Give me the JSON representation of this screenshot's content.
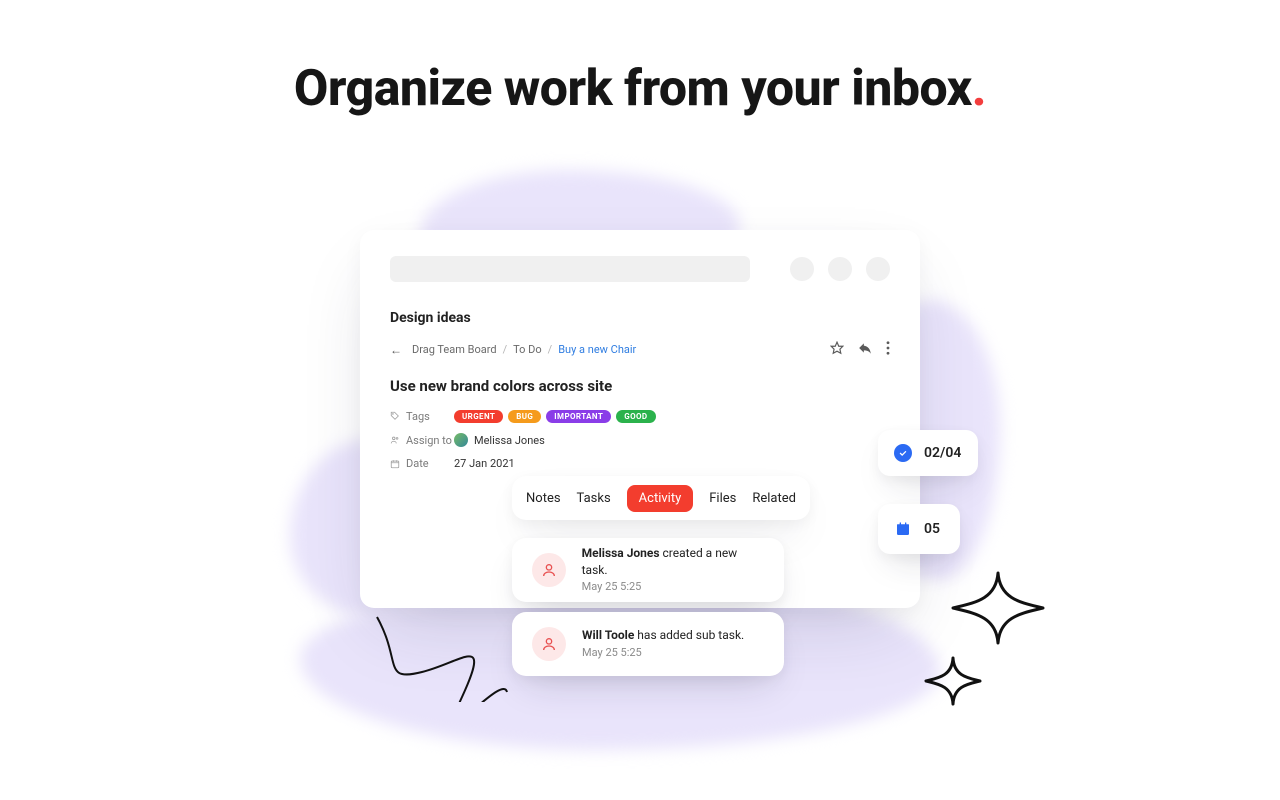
{
  "headline": "Organize work from your inbox",
  "card": {
    "section_title": "Design ideas",
    "breadcrumbs": {
      "b1": "Drag Team Board",
      "b2": "To Do",
      "b3": "Buy a new Chair"
    },
    "task_title": "Use new brand colors across site",
    "tags_label": "Tags",
    "tags": [
      {
        "text": "URGENT",
        "color": "#f33d2e"
      },
      {
        "text": "BUG",
        "color": "#f59b1c"
      },
      {
        "text": "IMPORTANT",
        "color": "#8a3de8"
      },
      {
        "text": "GOOD",
        "color": "#2bb24c"
      }
    ],
    "assign_label": "Assign to",
    "assignee": "Melissa Jones",
    "date_label": "Date",
    "date_value": "27 Jan 2021"
  },
  "tabs": {
    "t1": "Notes",
    "t2": "Tasks",
    "t3": "Activity",
    "t4": "Files",
    "t5": "Related"
  },
  "activity": {
    "a1": {
      "name": "Melissa Jones",
      "rest": " created a new task.",
      "time": "May 25 5:25"
    },
    "a2": {
      "name": "Will Toole",
      "rest": " has added sub task.",
      "time": "May 25 5:25"
    }
  },
  "chips": {
    "progress": "02/04",
    "day": "05"
  }
}
